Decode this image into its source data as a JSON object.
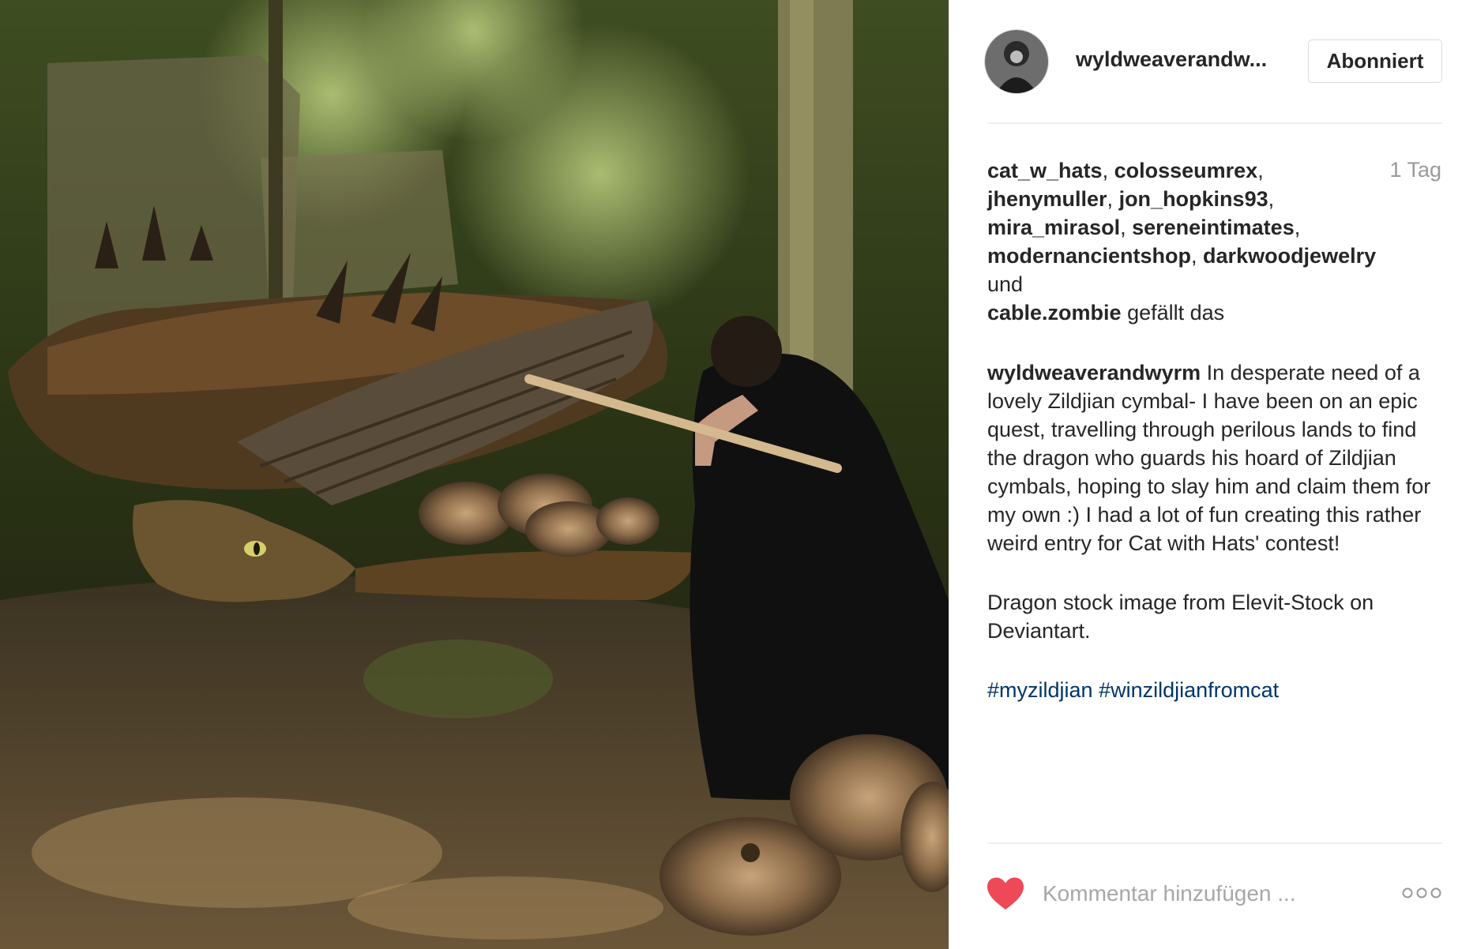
{
  "post": {
    "image_alt": "Person in a black cloak holding a drumstick facing a sleeping dragon surrounded by cymbals in a forest"
  },
  "header": {
    "username": "wyldweaverandw...",
    "follow_label": "Abonniert"
  },
  "likes": {
    "users": [
      "cat_w_hats",
      "colosseumrex",
      "jhenymuller",
      "jon_hopkins93",
      "mira_mirasol",
      "sereneintimates",
      "modernancientshop",
      "darkwoodjewelry"
    ],
    "conjunction": "und",
    "last_user": "cable.zombie",
    "suffix": "gefällt das",
    "time": "1 Tag"
  },
  "caption": {
    "author": "wyldweaverandwyrm",
    "text": "In desperate need of a lovely Zildjian cymbal- I have been on an epic quest, travelling through perilous lands to find the dragon who guards his hoard of Zildjian cymbals, hoping to slay him and claim them for my own :) I had a lot of fun creating this rather weird entry for Cat with Hats' contest!",
    "credit": "Dragon stock image from Elevit-Stock on Deviantart.",
    "hashtags": [
      "#myzildjian",
      "#winzildjianfromcat"
    ]
  },
  "comment": {
    "placeholder": "Kommentar hinzufügen ..."
  },
  "icons": {
    "heart": "heart-icon",
    "more": "more-options-icon"
  },
  "colors": {
    "heart": "#ed4956",
    "hashtag": "#003569",
    "muted": "#999999"
  }
}
